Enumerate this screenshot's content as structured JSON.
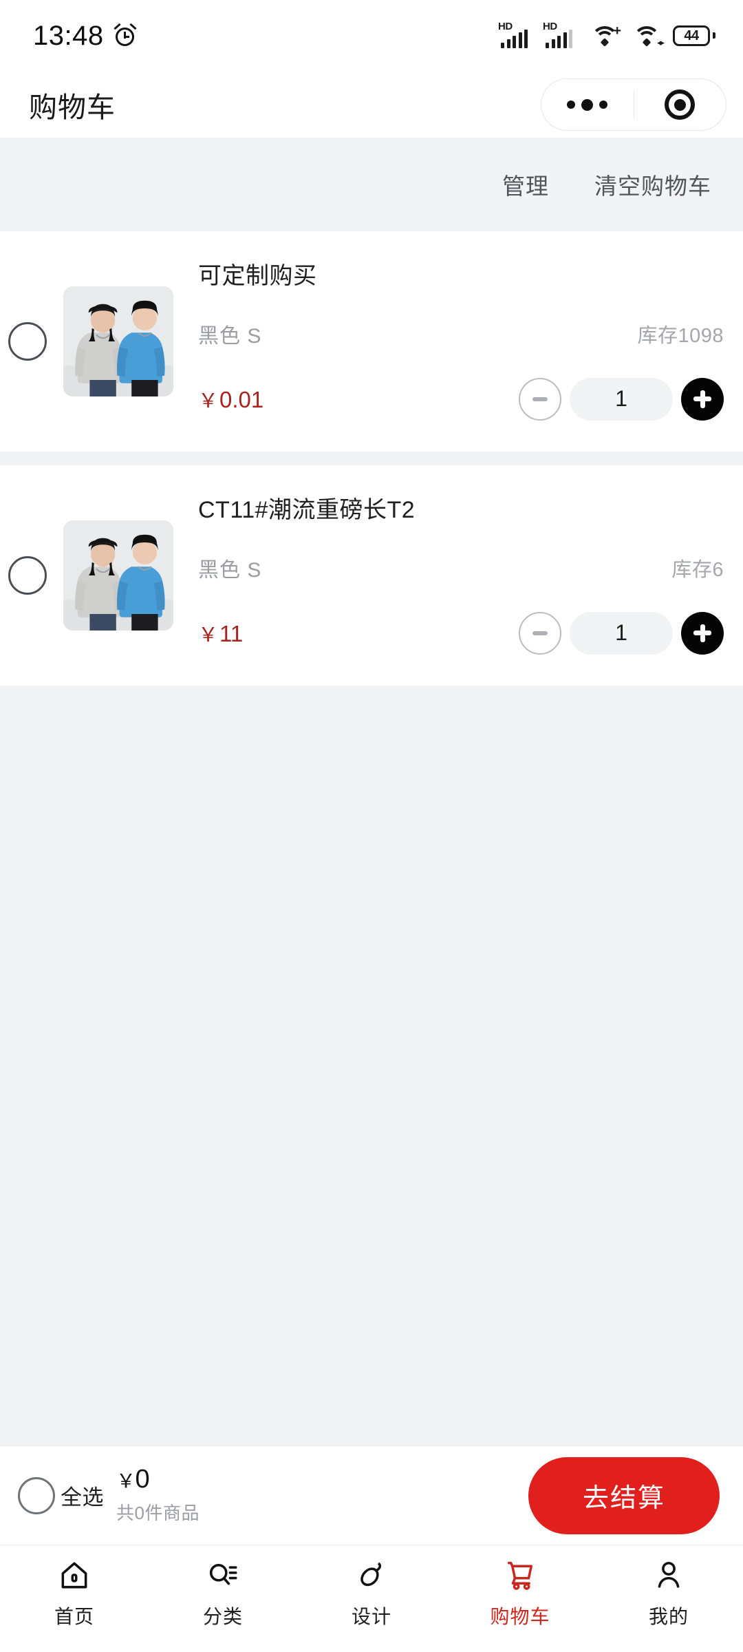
{
  "status_bar": {
    "time": "13:48",
    "alarm_icon": "alarm-clock-icon",
    "signal_1_label": "HD",
    "signal_2_label": "HD",
    "wifi_plus_icon": "wifi-plus-icon",
    "wifi_data_icon": "wifi-data-icon",
    "battery_level": "44"
  },
  "header": {
    "title": "购物车",
    "more_icon": "more-dots-icon",
    "target_icon": "target-circle-icon"
  },
  "toolbar": {
    "manage_label": "管理",
    "clear_cart_label": "清空购物车"
  },
  "cart": {
    "items": [
      {
        "checkbox": "unchecked",
        "thumbnail": "product-photo-two-models-long-sleeve-tees",
        "title": "可定制购买",
        "spec": "黑色 S",
        "stock": "库存1098",
        "price": "0.01",
        "currency": "￥",
        "quantity": "1",
        "minus_icon": "minus-icon",
        "plus_icon": "plus-icon"
      },
      {
        "checkbox": "unchecked",
        "thumbnail": "product-photo-two-models-long-sleeve-tees",
        "title": "CT11#潮流重磅长T2",
        "spec": "黑色 S",
        "stock": "库存6",
        "price": "11",
        "currency": "￥",
        "quantity": "1",
        "minus_icon": "minus-icon",
        "plus_icon": "plus-icon"
      }
    ]
  },
  "checkout_bar": {
    "select_all_label": "全选",
    "total_currency": "￥",
    "total_amount": "0",
    "total_count_label": "共0件商品",
    "checkout_button": "去结算"
  },
  "tab_bar": {
    "tabs": [
      {
        "label": "首页",
        "icon": "home-icon",
        "active": false
      },
      {
        "label": "分类",
        "icon": "search-list-icon",
        "active": false
      },
      {
        "label": "设计",
        "icon": "brush-icon",
        "active": false
      },
      {
        "label": "购物车",
        "icon": "cart-icon",
        "active": true
      },
      {
        "label": "我的",
        "icon": "person-icon",
        "active": false
      }
    ]
  },
  "colors": {
    "accent_red": "#e11f1c",
    "active_tab_red": "#c8281e",
    "price_red": "#a8221f",
    "page_bg": "#f2f3f5",
    "card_bg": "#ffffff"
  }
}
